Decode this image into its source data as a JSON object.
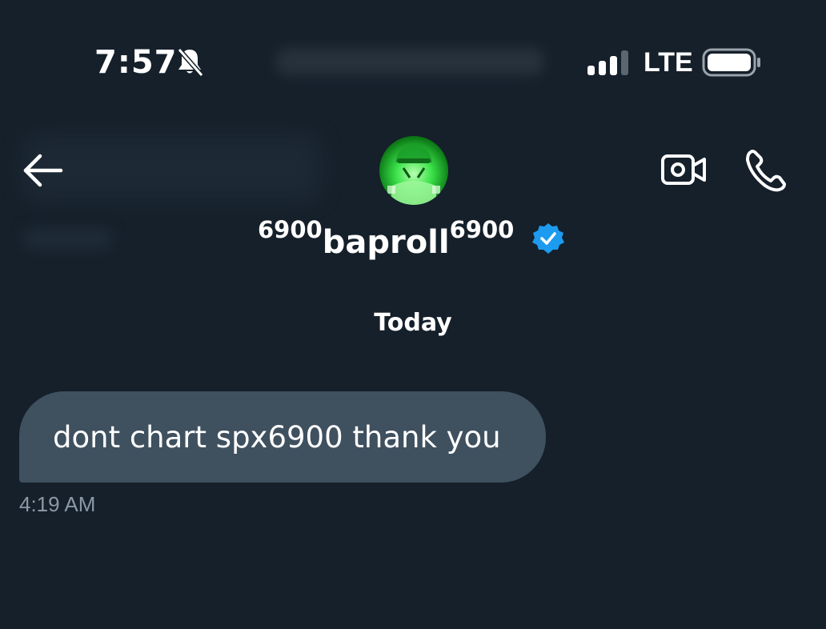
{
  "status_bar": {
    "time": "7:57",
    "network": "LTE",
    "icons": [
      "bell-slash-icon",
      "signal-icon",
      "battery-icon"
    ]
  },
  "header": {
    "back_icon": "arrow-left-icon",
    "username_prefix": "6900",
    "username_main": "baproll",
    "username_suffix": "6900",
    "verified_icon": "verified-badge-icon",
    "actions": [
      "video-call-icon",
      "phone-call-icon"
    ]
  },
  "conversation": {
    "day_label": "Today",
    "messages": [
      {
        "text": "dont chart spx6900 thank you",
        "time": "4:19 AM"
      }
    ]
  },
  "colors": {
    "background": "#15202b",
    "bubble": "#3f505f",
    "verified": "#1d9bf0",
    "timestamp": "#8b98a5",
    "avatar_accent": "#3be24a"
  }
}
